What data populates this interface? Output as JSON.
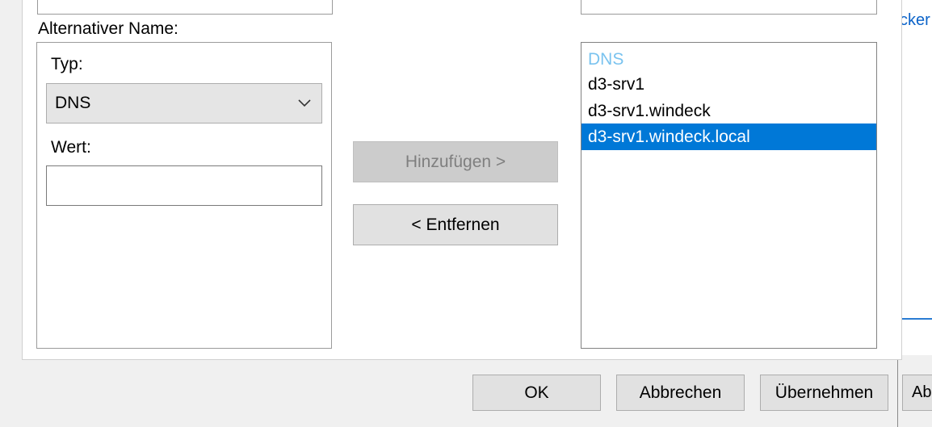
{
  "window": {
    "background_link_text": "cker",
    "background_button_label": "Ab"
  },
  "left_group": {
    "title": "Alternativer Name:",
    "type_label": "Typ:",
    "type_value": "DNS",
    "value_label": "Wert:",
    "value_input": ""
  },
  "middle": {
    "add_button": "Hinzufügen >",
    "remove_button": "< Entfernen"
  },
  "right_list": {
    "header": "DNS",
    "items": [
      "d3-srv1",
      "d3-srv1.windeck",
      "d3-srv1.windeck.local"
    ],
    "selected_index": 2
  },
  "footer": {
    "ok": "OK",
    "cancel": "Abbrechen",
    "apply": "Übernehmen"
  },
  "colors": {
    "selection": "#0078d7",
    "list_header": "#7ac3ef",
    "link": "#0b63c9"
  }
}
